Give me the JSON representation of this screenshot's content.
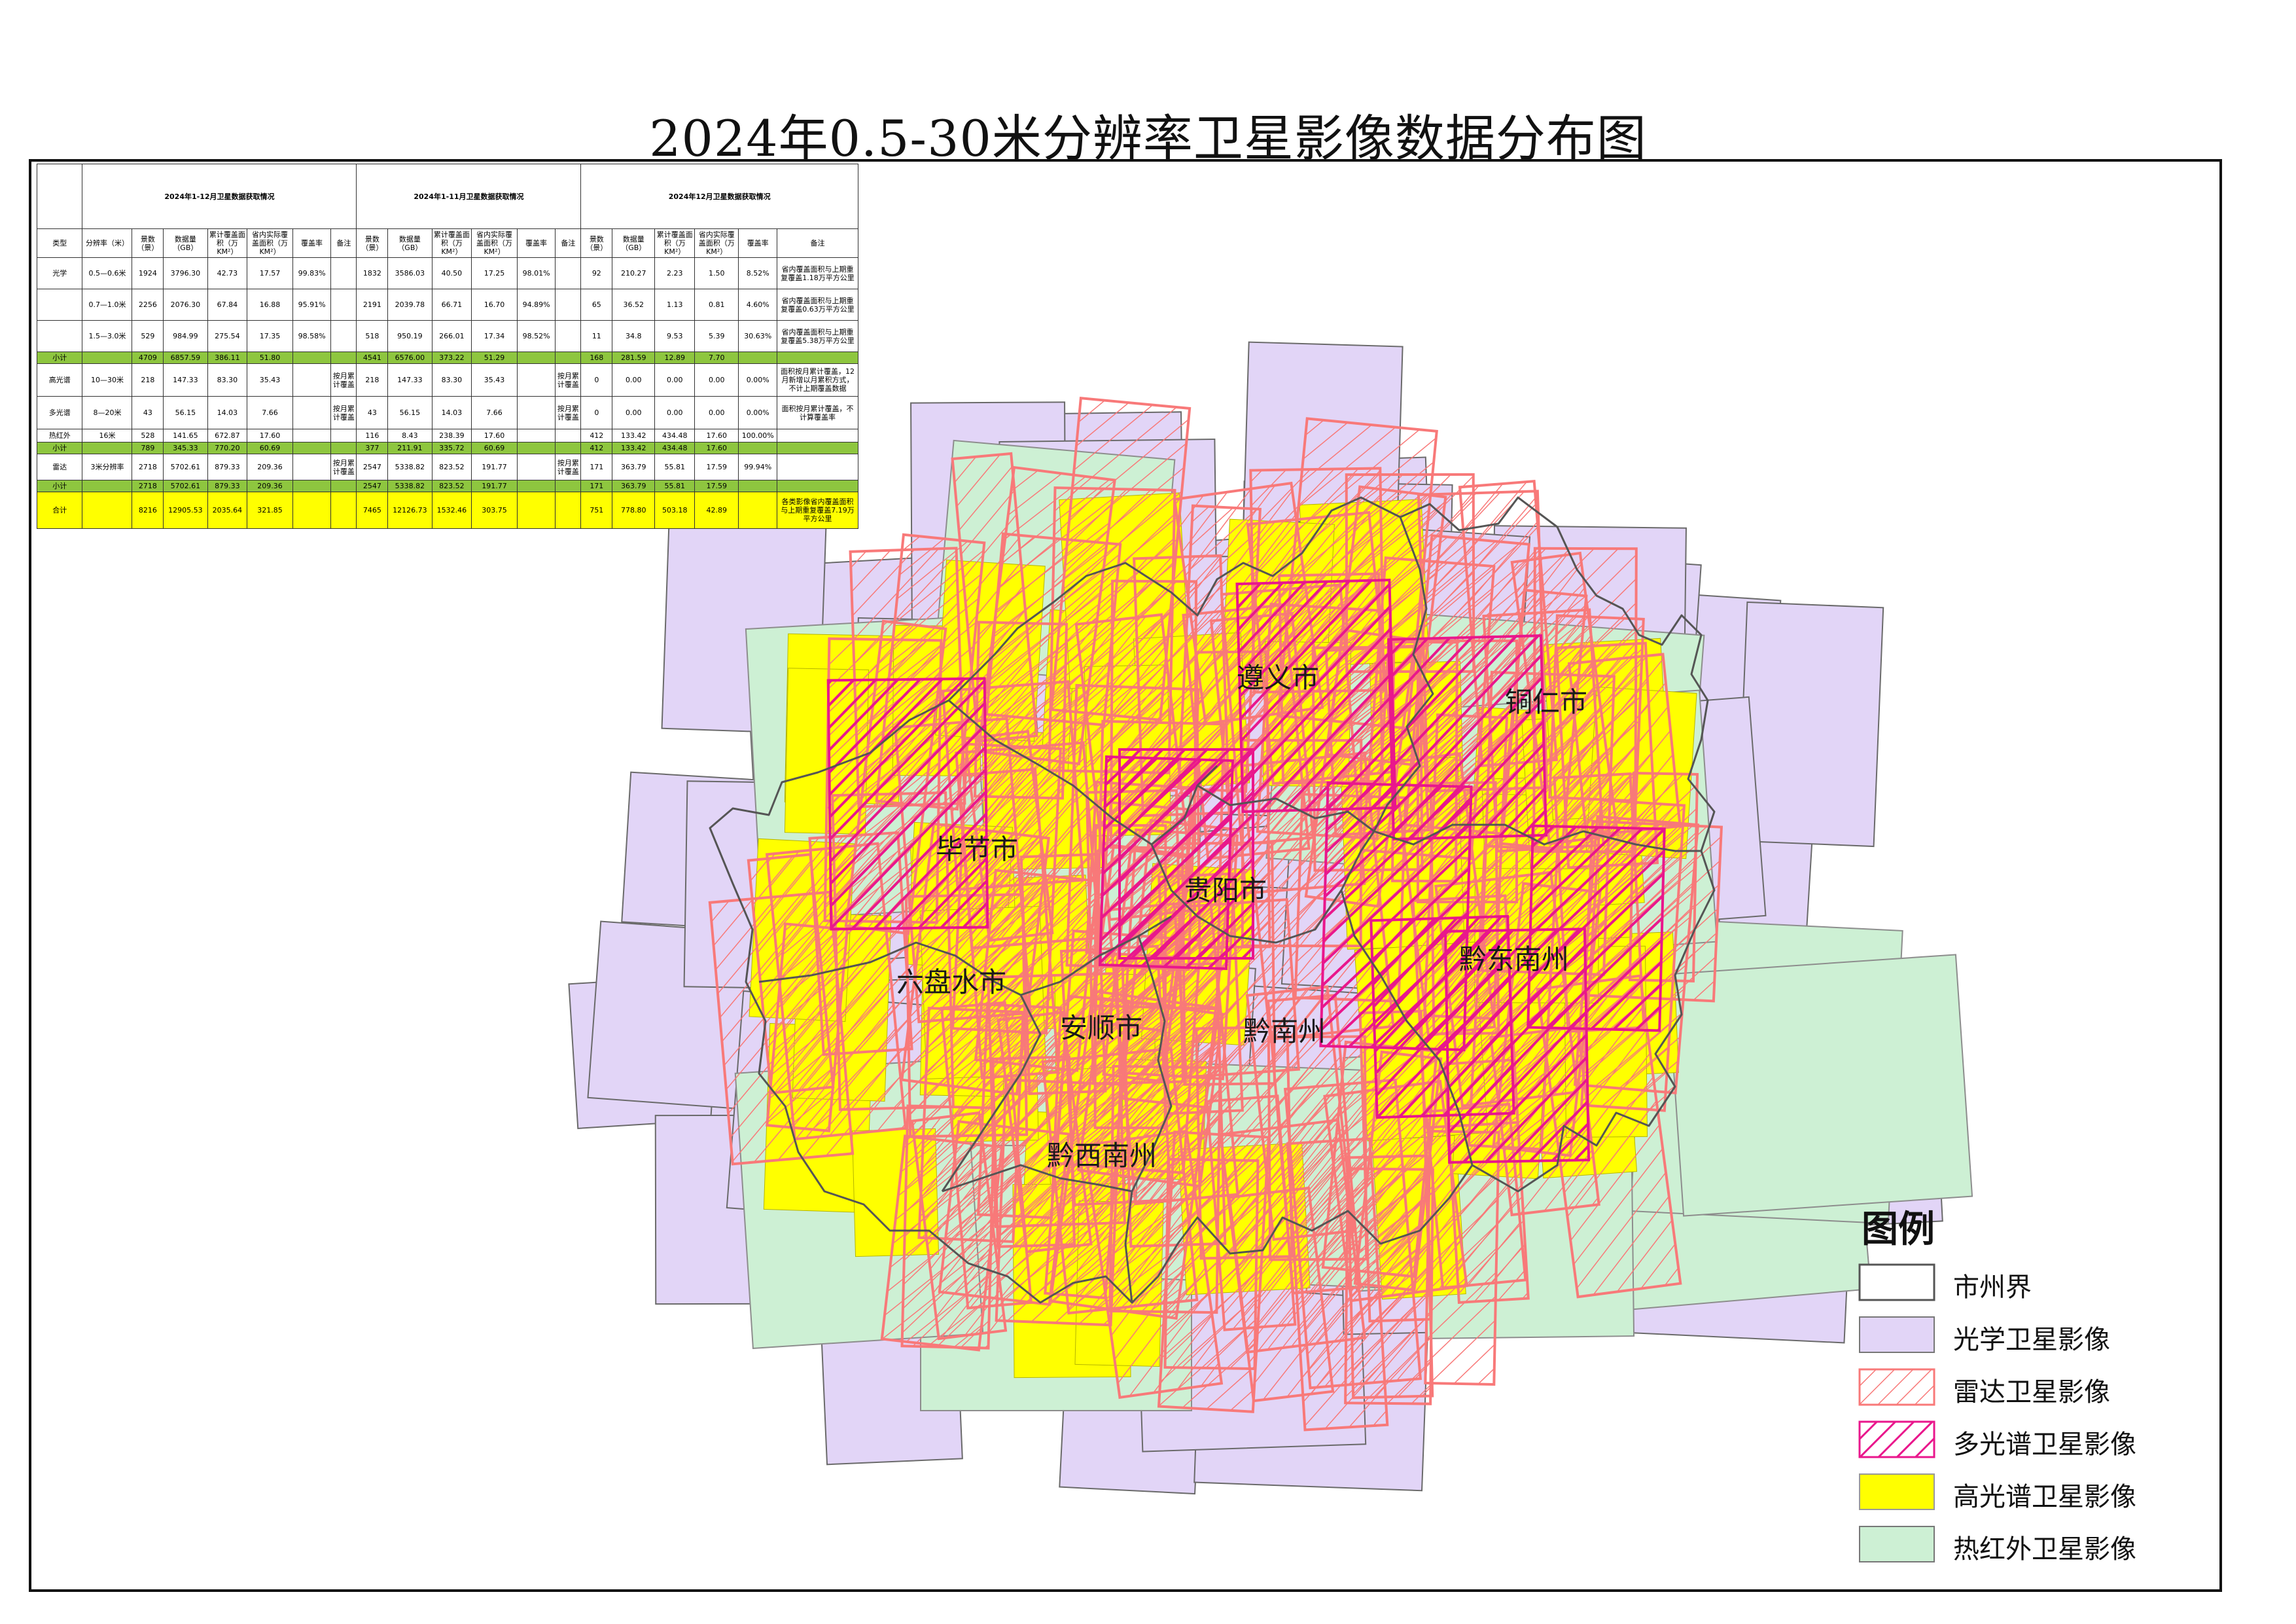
{
  "title": "2024年0.5-30米分辨率卫星影像数据分布图",
  "colors": {
    "optical": "#e2d5f7",
    "thermal": "#cdf0d4",
    "hyperspectral": "#ffff00",
    "radar": "#f87979",
    "multispectral": "#e9178c",
    "boundary": "#555555"
  },
  "cities": [
    "遵义市",
    "铜仁市",
    "毕节市",
    "贵阳市",
    "六盘水市",
    "安顺市",
    "黔南州",
    "黔东南州",
    "黔西南州"
  ],
  "legend": {
    "title": "图例",
    "items": [
      {
        "label": "市州界",
        "type": "boundary"
      },
      {
        "label": "光学卫星影像",
        "type": "optical"
      },
      {
        "label": "雷达卫星影像",
        "type": "radar"
      },
      {
        "label": "多光谱卫星影像",
        "type": "multispectral"
      },
      {
        "label": "高光谱卫星影像",
        "type": "hyperspectral"
      },
      {
        "label": "热红外卫星影像",
        "type": "thermal"
      }
    ]
  },
  "table": {
    "group_headers": [
      "2024年1-12月卫星数据获取情况",
      "2024年1-11月卫星数据获取情况",
      "2024年12月卫星数据获取情况"
    ],
    "columns": [
      "类型",
      "分辨率（米）",
      "景数（景）",
      "数据量（GB）",
      "累计覆盖面积（万KM²）",
      "省内实际覆盖面积（万KM²）",
      "覆盖率",
      "备注",
      "景数（景）",
      "数据量（GB）",
      "累计覆盖面积（万KM²）",
      "省内实际覆盖面积（万KM²）",
      "覆盖率",
      "备注",
      "景数（景）",
      "数据量（GB）",
      "累计覆盖面积（万KM²）",
      "省内实际覆盖面积（万KM²）",
      "覆盖率",
      "备注"
    ],
    "rows": [
      {
        "type": "光学",
        "cells": [
          "0.5—0.6米",
          "1924",
          "3796.30",
          "42.73",
          "17.57",
          "99.83%",
          "",
          "1832",
          "3586.03",
          "40.50",
          "17.25",
          "98.01%",
          "",
          "92",
          "210.27",
          "2.23",
          "1.50",
          "8.52%",
          "省内覆盖面积与上期重复覆盖1.18万平方公里"
        ]
      },
      {
        "type": "",
        "cells": [
          "0.7—1.0米",
          "2256",
          "2076.30",
          "67.84",
          "16.88",
          "95.91%",
          "",
          "2191",
          "2039.78",
          "66.71",
          "16.70",
          "94.89%",
          "",
          "65",
          "36.52",
          "1.13",
          "0.81",
          "4.60%",
          "省内覆盖面积与上期重复覆盖0.63万平方公里"
        ]
      },
      {
        "type": "",
        "cells": [
          "1.5—3.0米",
          "529",
          "984.99",
          "275.54",
          "17.35",
          "98.58%",
          "",
          "518",
          "950.19",
          "266.01",
          "17.34",
          "98.52%",
          "",
          "11",
          "34.8",
          "9.53",
          "5.39",
          "30.63%",
          "省内覆盖面积与上期重复覆盖5.38万平方公里"
        ]
      },
      {
        "type": "小计",
        "cells": [
          "",
          "4709",
          "6857.59",
          "386.11",
          "51.80",
          "",
          "",
          "4541",
          "6576.00",
          "373.22",
          "51.29",
          "",
          "",
          "168",
          "281.59",
          "12.89",
          "7.70",
          "",
          ""
        ]
      },
      {
        "type": "高光谱",
        "cells": [
          "10—30米",
          "218",
          "147.33",
          "83.30",
          "35.43",
          "",
          "按月累计覆盖",
          "218",
          "147.33",
          "83.30",
          "35.43",
          "",
          "按月累计覆盖",
          "0",
          "0.00",
          "0.00",
          "0.00",
          "0.00%",
          "面积按月累计覆盖，12月新增以月累积方式，不计上期覆盖数据"
        ]
      },
      {
        "type": "多光谱",
        "cells": [
          "8—20米",
          "43",
          "56.15",
          "14.03",
          "7.66",
          "",
          "按月累计覆盖",
          "43",
          "56.15",
          "14.03",
          "7.66",
          "",
          "按月累计覆盖",
          "0",
          "0.00",
          "0.00",
          "0.00",
          "0.00%",
          "面积按月累计覆盖，不计算覆盖率"
        ]
      },
      {
        "type": "热红外",
        "cells": [
          "16米",
          "528",
          "141.65",
          "672.87",
          "17.60",
          "",
          "",
          "116",
          "8.43",
          "238.39",
          "17.60",
          "",
          "",
          "412",
          "133.42",
          "434.48",
          "17.60",
          "100.00%",
          ""
        ]
      },
      {
        "type": "小计",
        "cells": [
          "",
          "789",
          "345.33",
          "770.20",
          "60.69",
          "",
          "",
          "377",
          "211.91",
          "335.72",
          "60.69",
          "",
          "",
          "412",
          "133.42",
          "434.48",
          "17.60",
          "",
          ""
        ]
      },
      {
        "type": "雷达",
        "cells": [
          "3米分辨率",
          "2718",
          "5702.61",
          "879.33",
          "209.36",
          "",
          "按月累计覆盖",
          "2547",
          "5338.82",
          "823.52",
          "191.77",
          "",
          "按月累计覆盖",
          "171",
          "363.79",
          "55.81",
          "17.59",
          "99.94%",
          ""
        ]
      },
      {
        "type": "小计",
        "cells": [
          "",
          "2718",
          "5702.61",
          "879.33",
          "209.36",
          "",
          "",
          "2547",
          "5338.82",
          "823.52",
          "191.77",
          "",
          "",
          "171",
          "363.79",
          "55.81",
          "17.59",
          "",
          ""
        ]
      },
      {
        "type": "合计",
        "cells": [
          "",
          "8216",
          "12905.53",
          "2035.64",
          "321.85",
          "",
          "",
          "7465",
          "12126.73",
          "1532.46",
          "303.75",
          "",
          "",
          "751",
          "778.80",
          "503.18",
          "42.89",
          "",
          "各类影像省内覆盖面积与上期重复覆盖7.19万平方公里"
        ]
      }
    ]
  }
}
